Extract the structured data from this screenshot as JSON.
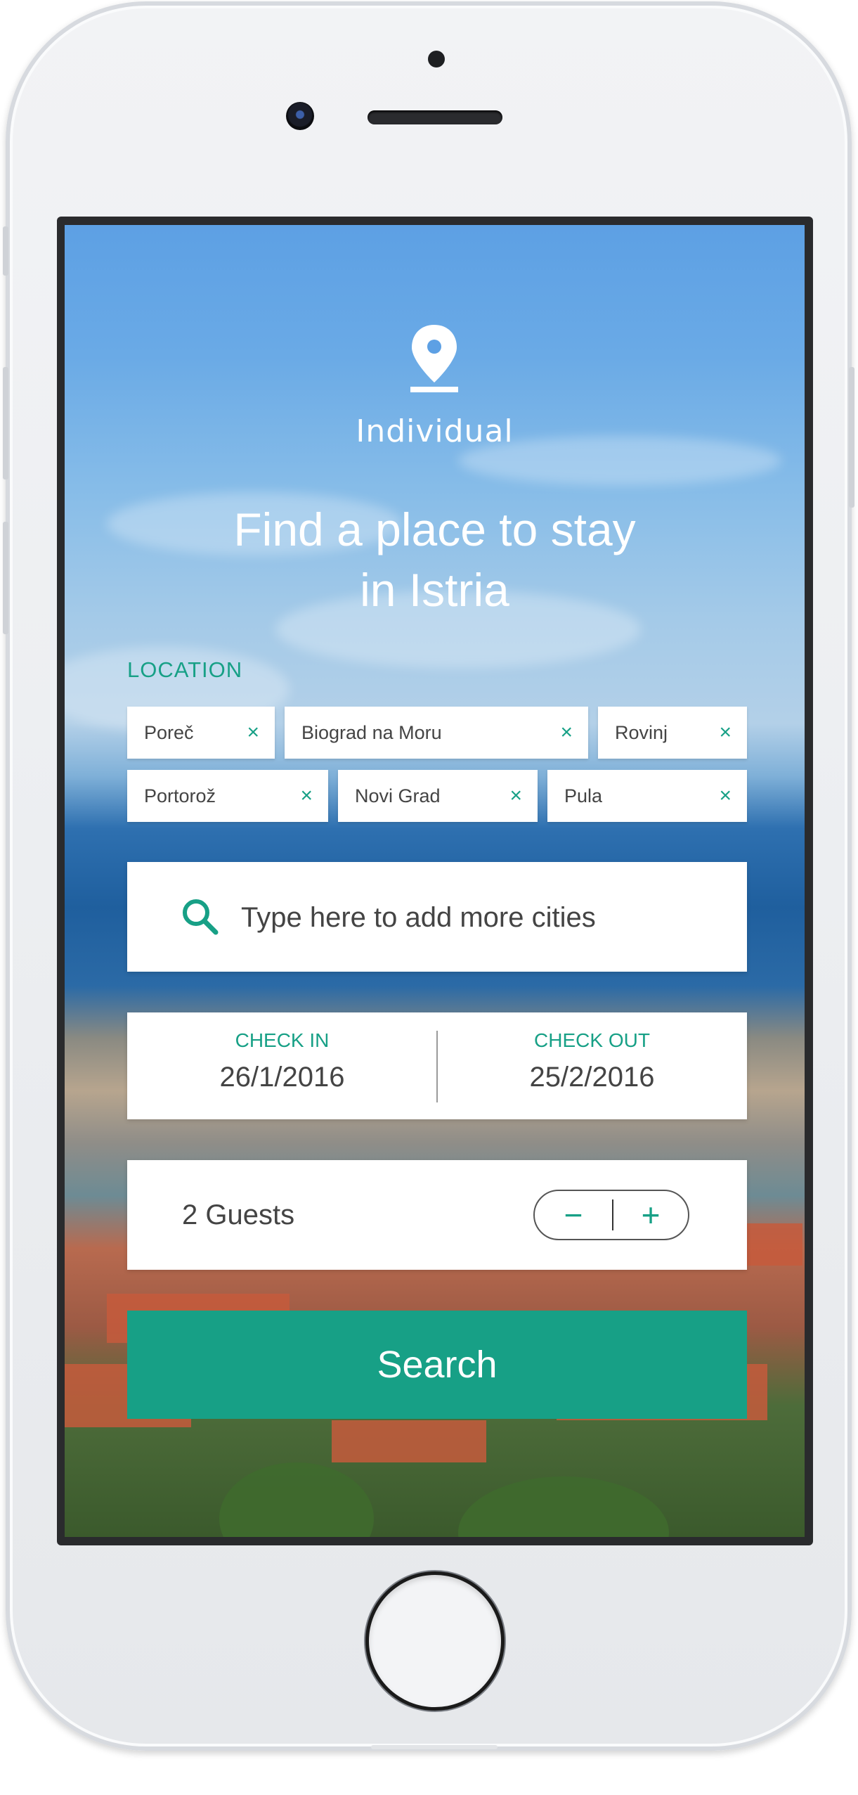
{
  "app": {
    "brand_name": "Individual",
    "brand_icon": "location-pin-icon",
    "headline_line1": "Find a place to stay",
    "headline_line2": "in Istria"
  },
  "colors": {
    "accent": "#17a086",
    "card_background": "#ffffff",
    "text": "#444444"
  },
  "location": {
    "label": "LOCATION",
    "chips": [
      {
        "label": "Poreč",
        "remove_icon": "close-icon"
      },
      {
        "label": "Biograd na Moru",
        "remove_icon": "close-icon"
      },
      {
        "label": "Rovinj",
        "remove_icon": "close-icon"
      },
      {
        "label": "Portorož",
        "remove_icon": "close-icon"
      },
      {
        "label": "Novi Grad",
        "remove_icon": "close-icon"
      },
      {
        "label": "Pula",
        "remove_icon": "close-icon"
      }
    ],
    "remove_glyph": "×"
  },
  "search": {
    "placeholder": "Type here to add more cities",
    "icon": "search-icon"
  },
  "dates": {
    "check_in_label": "CHECK IN",
    "check_in_value": "26/1/2016",
    "check_out_label": "CHECK OUT",
    "check_out_value": "25/2/2016"
  },
  "guests": {
    "label": "2 Guests",
    "minus": "−",
    "plus": "+"
  },
  "actions": {
    "search_label": "Search"
  }
}
